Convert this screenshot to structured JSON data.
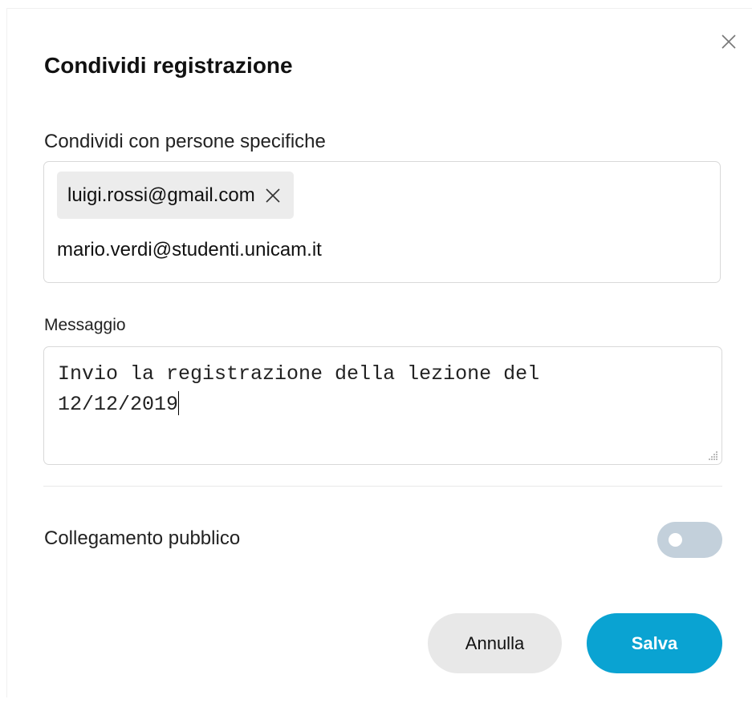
{
  "dialog": {
    "title": "Condividi registrazione",
    "close_icon": "close-icon"
  },
  "share": {
    "label": "Condividi con persone specifiche",
    "recipients": [
      {
        "email": "luigi.rossi@gmail.com",
        "remove_icon": "close-icon"
      }
    ],
    "input_value": "mario.verdi@studenti.unicam.it"
  },
  "message": {
    "label": "Messaggio",
    "value": "Invio la registrazione della lezione del\n12/12/2019"
  },
  "public_link": {
    "label": "Collegamento pubblico",
    "enabled": false
  },
  "actions": {
    "cancel_label": "Annulla",
    "save_label": "Salva"
  },
  "colors": {
    "accent": "#0aa3d2",
    "toggle_off": "#c3d0db",
    "chip_bg": "#ececec",
    "cancel_bg": "#e8e8e8"
  }
}
